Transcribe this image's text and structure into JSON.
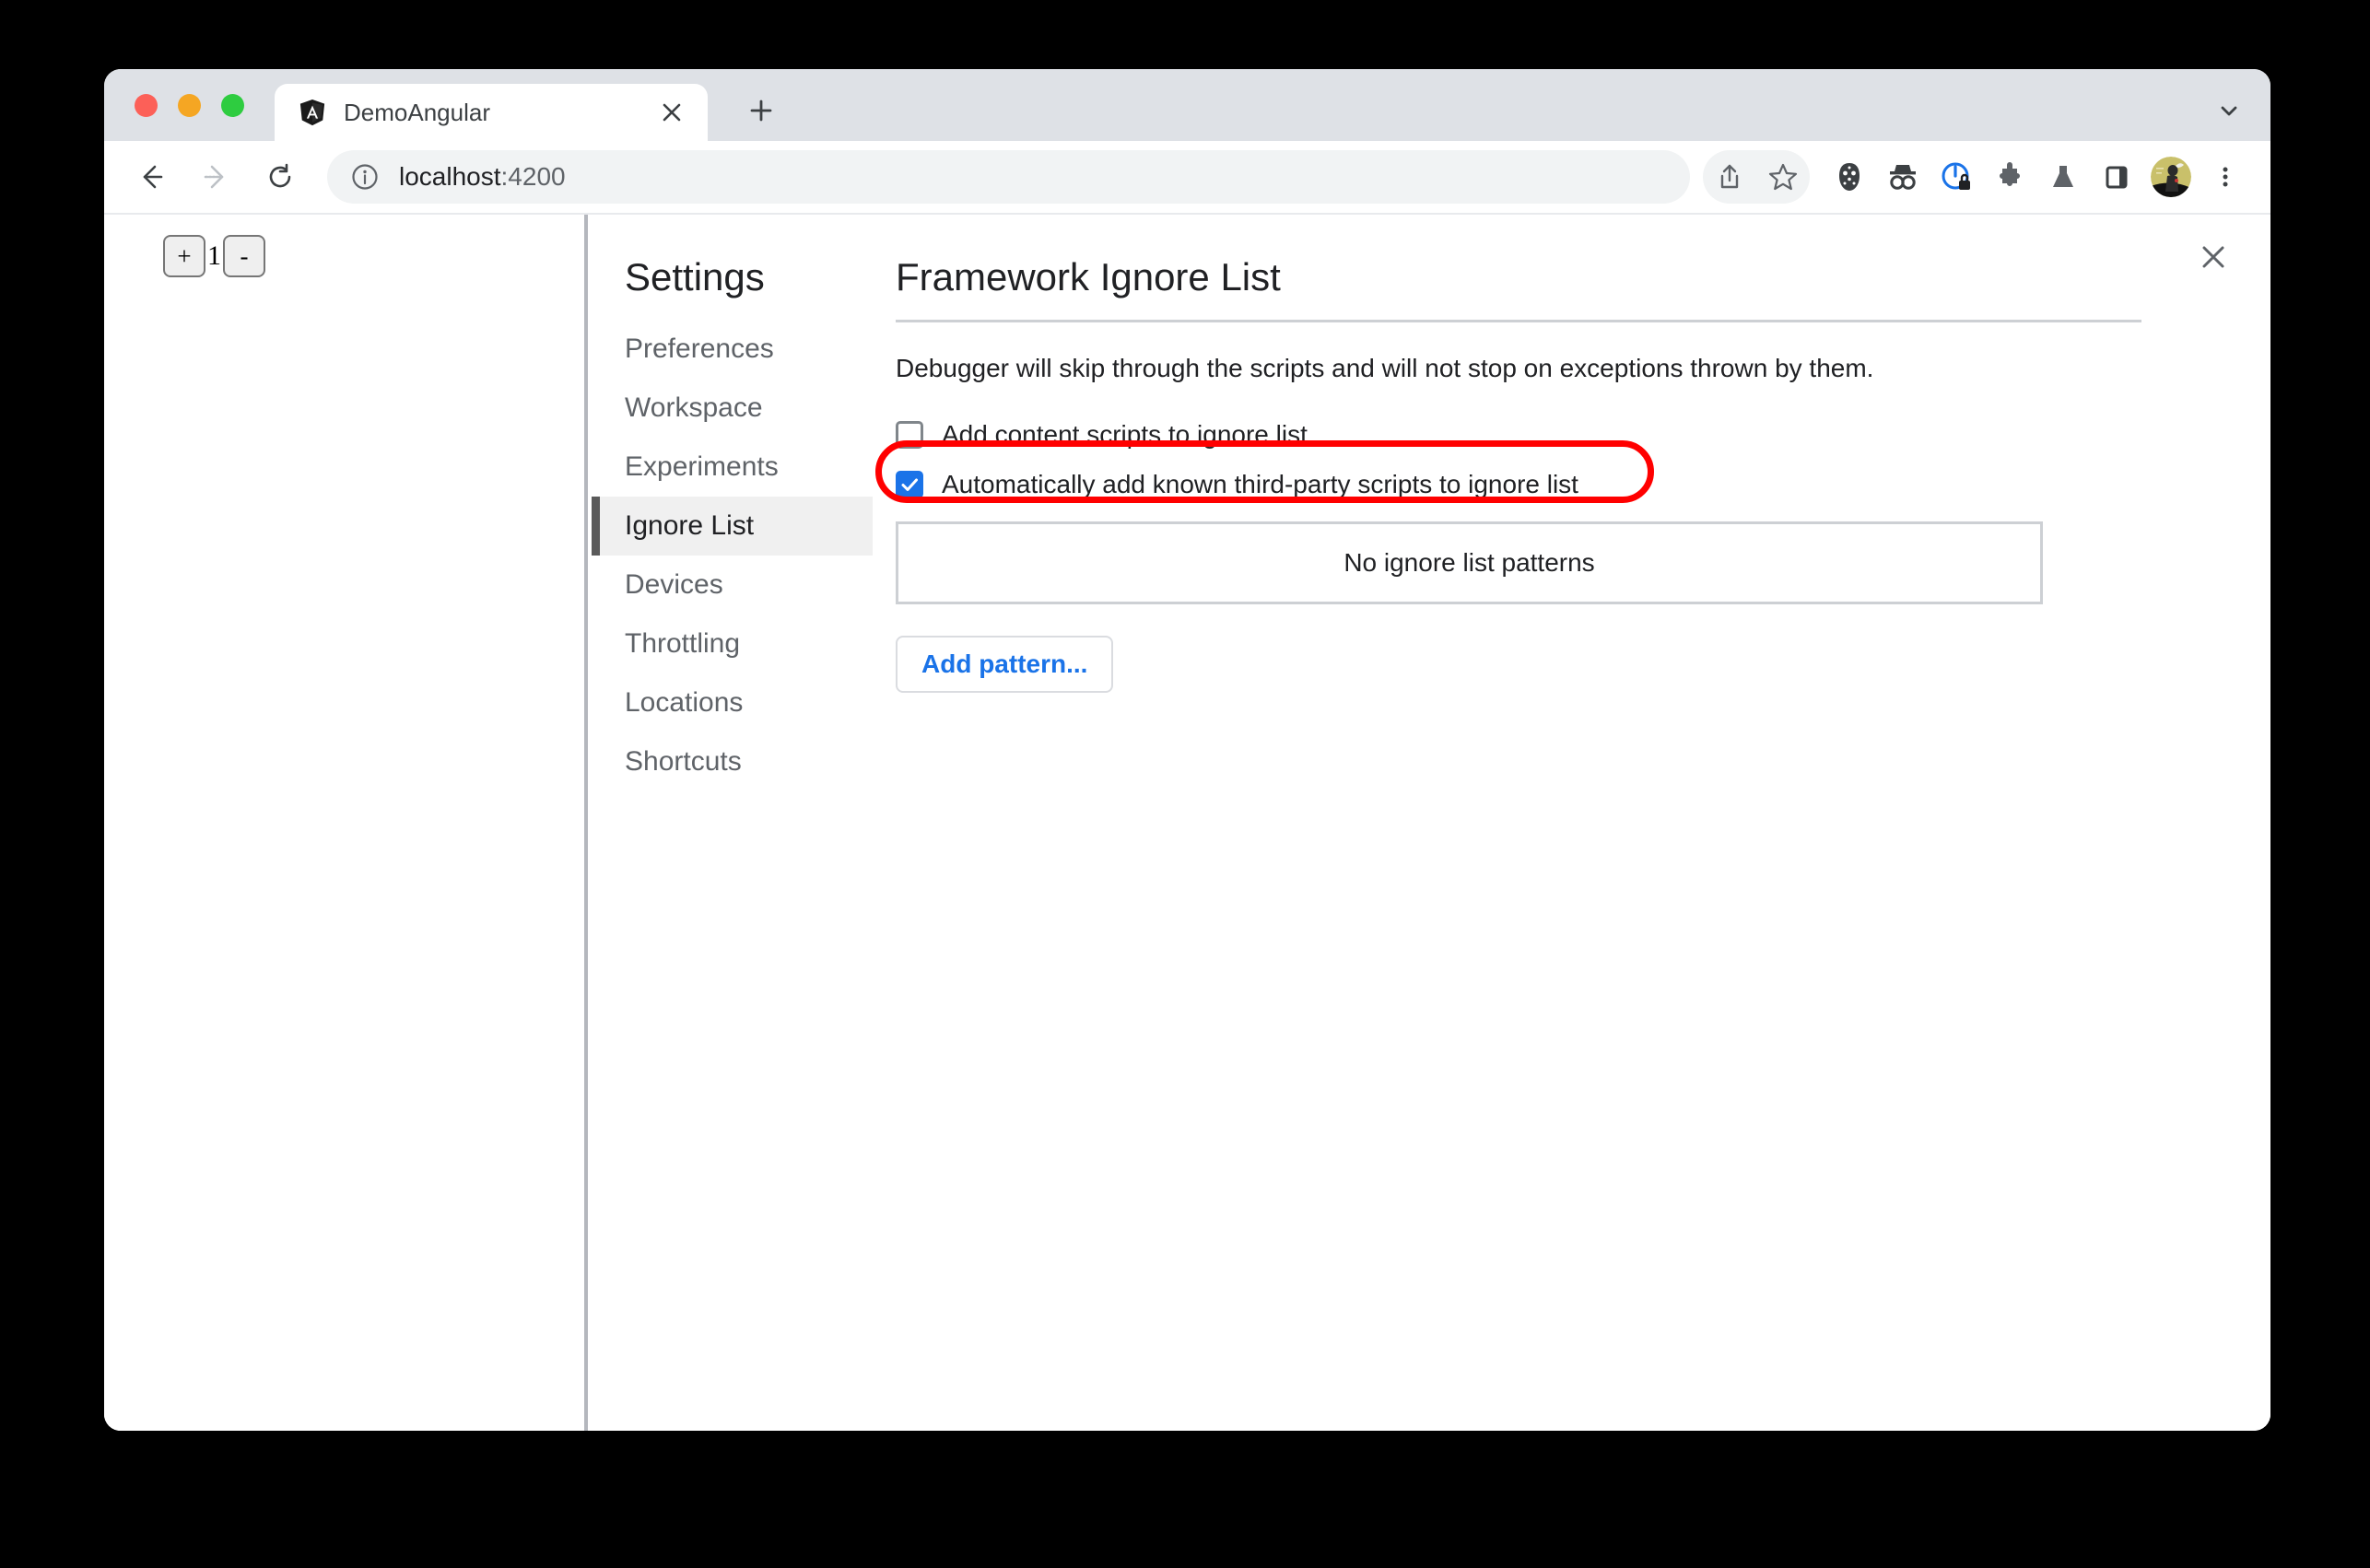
{
  "browser": {
    "tab": {
      "title": "DemoAngular",
      "favicon_icon": "angular-logo-icon",
      "close_icon": "close-icon"
    },
    "new_tab_icon": "plus-icon",
    "tab_list_icon": "chevron-down-icon",
    "toolbar": {
      "back_icon": "arrow-left-icon",
      "forward_icon": "arrow-right-icon",
      "reload_icon": "reload-icon",
      "site_info_icon": "info-circle-icon",
      "url": "localhost",
      "url_suffix": ":4200",
      "actions": [
        {
          "name": "share-icon"
        },
        {
          "name": "bookmark-star-icon"
        },
        {
          "name": "hockey-mask-icon"
        },
        {
          "name": "incognito-glasses-icon"
        },
        {
          "name": "privacy-lock-icon"
        },
        {
          "name": "extensions-puzzle-icon"
        },
        {
          "name": "experiments-flask-icon"
        },
        {
          "name": "side-panel-icon"
        }
      ],
      "avatar_icon": "user-avatar",
      "menu_icon": "three-dots-menu-icon"
    }
  },
  "page": {
    "counter": {
      "increment_label": "+",
      "value": "1",
      "decrement_label": "-"
    }
  },
  "settings": {
    "close_icon": "close-icon",
    "heading": "Settings",
    "sidebar_items": [
      {
        "label": "Preferences",
        "selected": false
      },
      {
        "label": "Workspace",
        "selected": false
      },
      {
        "label": "Experiments",
        "selected": false
      },
      {
        "label": "Ignore List",
        "selected": true
      },
      {
        "label": "Devices",
        "selected": false
      },
      {
        "label": "Throttling",
        "selected": false
      },
      {
        "label": "Locations",
        "selected": false
      },
      {
        "label": "Shortcuts",
        "selected": false
      }
    ],
    "main": {
      "title": "Framework Ignore List",
      "description": "Debugger will skip through the scripts and will not stop on exceptions thrown by them.",
      "checkboxes": [
        {
          "label": "Add content scripts to ignore list",
          "checked": false
        },
        {
          "label": "Automatically add known third-party scripts to ignore list",
          "checked": true
        }
      ],
      "patterns_empty_text": "No ignore list patterns",
      "add_pattern_label": "Add pattern..."
    }
  },
  "annotation": {
    "name": "red-highlight-box",
    "color": "#ff0000",
    "targets": "Automatically add known third-party scripts to ignore list"
  },
  "colors": {
    "accent_blue": "#1a73e8",
    "annotation_red": "#ff0000",
    "tab_strip": "#dee1e6",
    "selected_item_bg": "#f0f0f0"
  }
}
